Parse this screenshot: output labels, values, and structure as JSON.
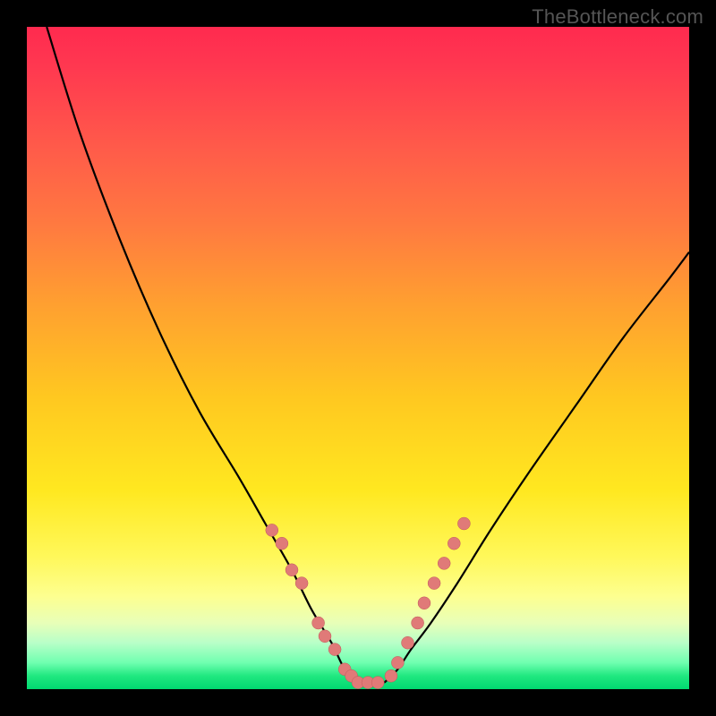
{
  "watermark": "TheBottleneck.com",
  "chart_data": {
    "type": "line",
    "title": "",
    "xlabel": "",
    "ylabel": "",
    "xlim": [
      0,
      100
    ],
    "ylim": [
      0,
      100
    ],
    "series": [
      {
        "name": "left-curve",
        "x": [
          3,
          8,
          14,
          20,
          26,
          32,
          36,
          40,
          43,
          46,
          48,
          50
        ],
        "y": [
          100,
          84,
          68,
          54,
          42,
          32,
          25,
          18,
          12,
          7,
          3,
          1
        ]
      },
      {
        "name": "right-curve",
        "x": [
          54,
          56,
          58,
          61,
          65,
          70,
          76,
          83,
          90,
          97,
          100
        ],
        "y": [
          1,
          3,
          6,
          10,
          16,
          24,
          33,
          43,
          53,
          62,
          66
        ]
      },
      {
        "name": "plateau",
        "x": [
          50,
          54
        ],
        "y": [
          1,
          1
        ]
      }
    ],
    "dots_left": {
      "x": [
        37,
        38.5,
        40,
        41.5,
        44,
        45,
        46.5,
        48,
        49
      ],
      "y": [
        24,
        22,
        18,
        16,
        10,
        8,
        6,
        3,
        2
      ]
    },
    "dots_right": {
      "x": [
        55,
        56,
        57.5,
        59,
        60,
        61.5,
        63,
        64.5,
        66
      ],
      "y": [
        2,
        4,
        7,
        10,
        13,
        16,
        19,
        22,
        25
      ]
    },
    "dots_bottom": {
      "x": [
        50,
        51.5,
        53
      ],
      "y": [
        1,
        1,
        1
      ]
    },
    "colors": {
      "gradient_top": "#ff2a4f",
      "gradient_mid_orange": "#ff9a30",
      "gradient_mid_yellow": "#ffe820",
      "gradient_bottom": "#00d870",
      "curve": "#000000",
      "dot_fill": "#e07a78",
      "frame": "#000000"
    }
  }
}
